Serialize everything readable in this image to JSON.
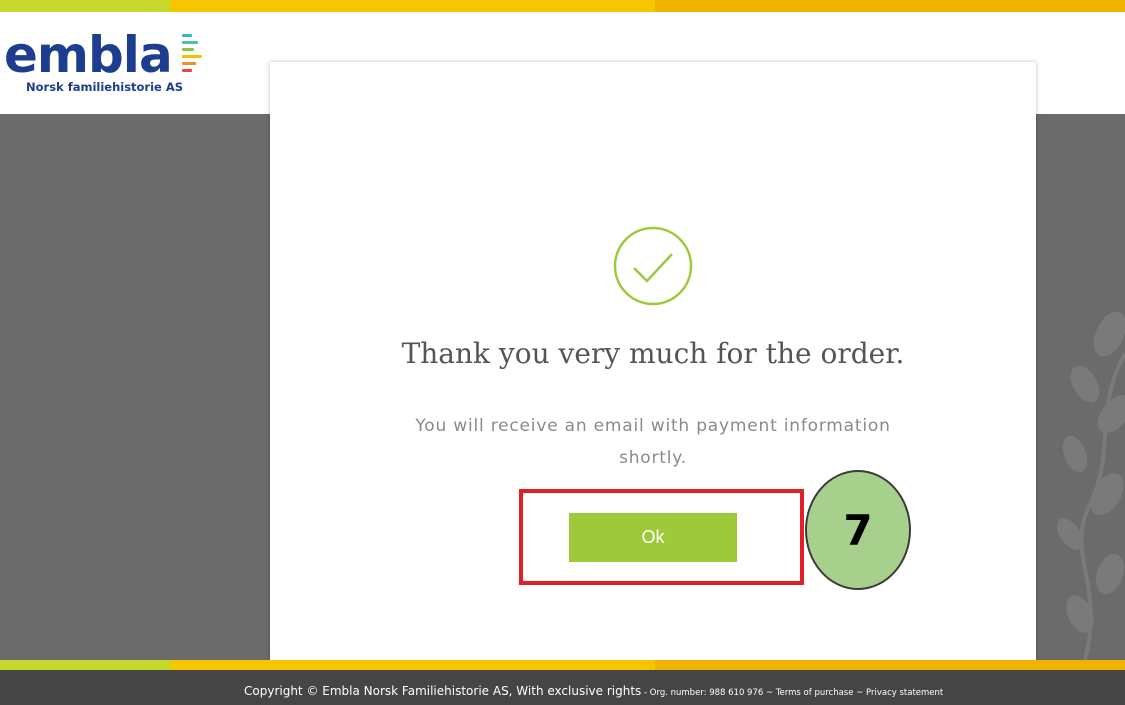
{
  "colors": {
    "stripe": [
      "#c5d92d",
      "#f5c500",
      "#f0b400"
    ],
    "accent_green": "#9ec93a",
    "highlight_red": "#e01f26",
    "step_circle": "#a8d08d",
    "logo_blue": "#1d3d8f"
  },
  "logo": {
    "word": "embla",
    "subtitle": "Norsk familiehistorie AS"
  },
  "dialog": {
    "icon": "check-circle-icon",
    "title": "Thank you very much for the order.",
    "message": "You will receive an email with payment information shortly.",
    "ok_label": "Ok"
  },
  "annotation": {
    "step": "7"
  },
  "footer": {
    "copyright": "Copyright © Embla Norsk Familiehistorie AS, With exclusive rights",
    "org": " - Org. number: 988 610 976 ~ ",
    "terms": "Terms of purchase",
    "sep": " ~ ",
    "privacy": "Privacy statement"
  }
}
